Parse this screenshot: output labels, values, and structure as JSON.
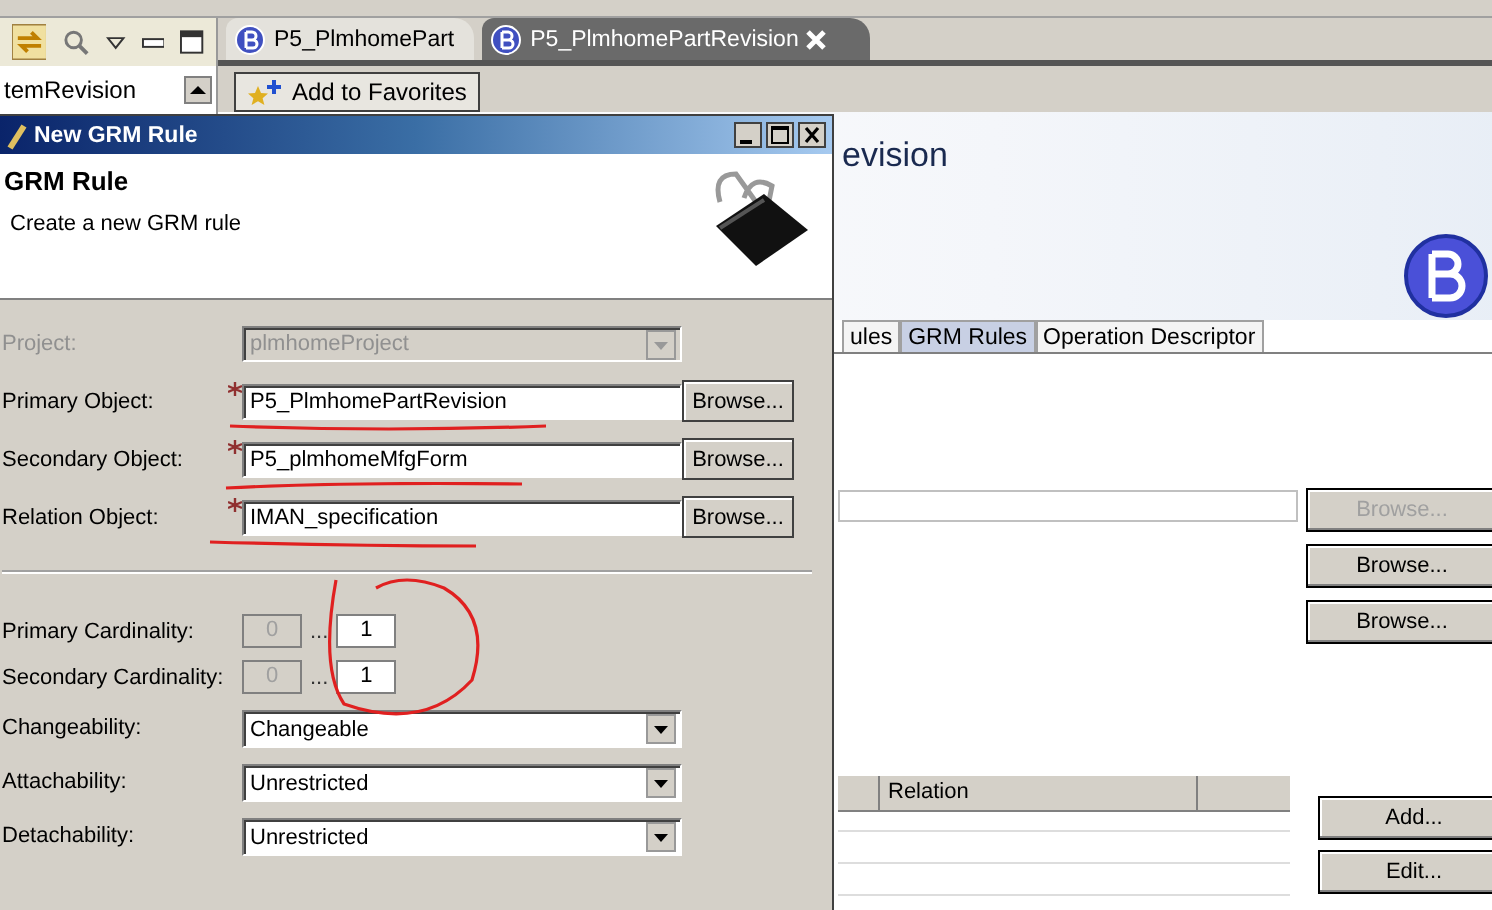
{
  "left_panel": {
    "type_combo": "temRevision"
  },
  "editor_tabs": [
    {
      "label": "P5_PlmhomePart",
      "selected": false,
      "closable": false
    },
    {
      "label": "P5_PlmhomePartRevision",
      "selected": true,
      "closable": true
    }
  ],
  "editor": {
    "favorites_button": "Add to Favorites",
    "title": "evision",
    "tabs": [
      {
        "label": "ules",
        "selected": false
      },
      {
        "label": "GRM Rules",
        "selected": true
      },
      {
        "label": "Operation Descriptor",
        "selected": false
      }
    ],
    "browse_buttons": [
      {
        "label": "Browse...",
        "disabled": true
      },
      {
        "label": "Browse...",
        "disabled": false
      },
      {
        "label": "Browse...",
        "disabled": false
      }
    ],
    "table": {
      "columns": [
        "Relation"
      ]
    },
    "side_buttons": [
      "Add...",
      "Edit..."
    ]
  },
  "dialog": {
    "title": "New GRM Rule",
    "heading": "GRM Rule",
    "description": "Create a new GRM rule",
    "fields": [
      {
        "kind": "combo",
        "label": "Project:",
        "value": "plmhomeProject",
        "disabled": true,
        "required": false
      },
      {
        "kind": "text",
        "label": "Primary Object:",
        "value": "P5_PlmhomePartRevision",
        "disabled": false,
        "required": true,
        "button": "Browse..."
      },
      {
        "kind": "text",
        "label": "Secondary Object:",
        "value": "P5_plmhomeMfgForm",
        "disabled": false,
        "required": true,
        "button": "Browse..."
      },
      {
        "kind": "text",
        "label": "Relation Object:",
        "value": "IMAN_specification",
        "disabled": false,
        "required": true,
        "button": "Browse..."
      }
    ],
    "cardinalities": [
      {
        "label": "Primary Cardinality:",
        "min": "0",
        "separator": "...",
        "max": "1"
      },
      {
        "label": "Secondary Cardinality:",
        "min": "0",
        "separator": "...",
        "max": "1"
      }
    ],
    "options": [
      {
        "label": "Changeability:",
        "value": "Changeable"
      },
      {
        "label": "Attachability:",
        "value": "Unrestricted"
      },
      {
        "label": "Detachability:",
        "value": "Unrestricted"
      }
    ]
  }
}
